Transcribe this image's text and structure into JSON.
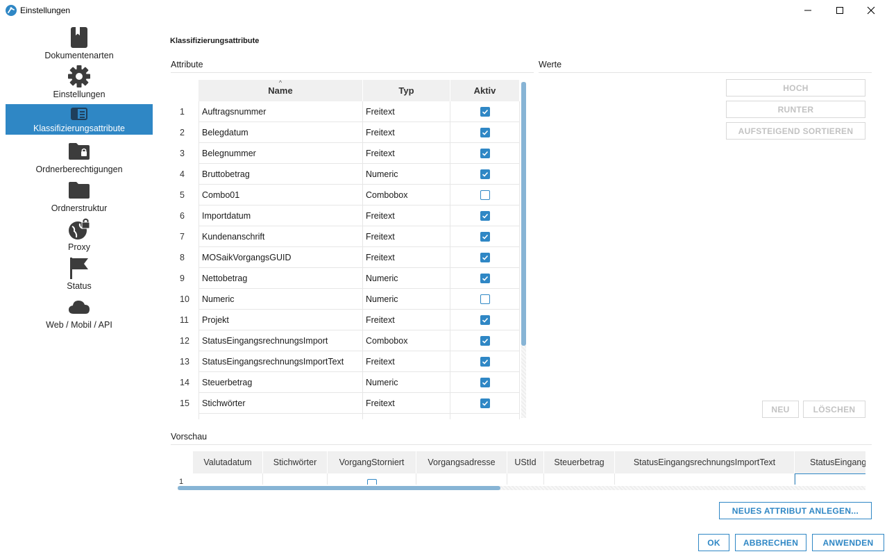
{
  "window": {
    "title": "Einstellungen"
  },
  "sidebar": {
    "items": [
      {
        "label": "Dokumentenarten",
        "icon": "bookmark-book-icon",
        "active": false
      },
      {
        "label": "Einstellungen",
        "icon": "gear-icon",
        "active": false
      },
      {
        "label": "Klassifizierungsattribute",
        "icon": "list-card-icon",
        "active": true
      },
      {
        "label": "Ordnerberechtigungen",
        "icon": "folder-lock-icon",
        "active": false
      },
      {
        "label": "Ordnerstruktur",
        "icon": "folder-icon",
        "active": false
      },
      {
        "label": "Proxy",
        "icon": "globe-lock-icon",
        "active": false
      },
      {
        "label": "Status",
        "icon": "flag-icon",
        "active": false
      },
      {
        "label": "Web / Mobil / API",
        "icon": "cloud-icon",
        "active": false
      }
    ]
  },
  "main": {
    "section_title": "Klassifizierungsattribute",
    "attributes_title": "Attribute",
    "values_title": "Werte",
    "preview_title": "Vorschau"
  },
  "attr_table": {
    "columns": [
      "Name",
      "Typ",
      "Aktiv"
    ],
    "sort_indicator": "^",
    "rows": [
      {
        "num": "1",
        "name": "Auftragsnummer",
        "typ": "Freitext",
        "aktiv": true
      },
      {
        "num": "2",
        "name": "Belegdatum",
        "typ": "Freitext",
        "aktiv": true
      },
      {
        "num": "3",
        "name": "Belegnummer",
        "typ": "Freitext",
        "aktiv": true
      },
      {
        "num": "4",
        "name": "Bruttobetrag",
        "typ": "Numeric",
        "aktiv": true
      },
      {
        "num": "5",
        "name": "Combo01",
        "typ": "Combobox",
        "aktiv": false
      },
      {
        "num": "6",
        "name": "Importdatum",
        "typ": "Freitext",
        "aktiv": true
      },
      {
        "num": "7",
        "name": "Kundenanschrift",
        "typ": "Freitext",
        "aktiv": true
      },
      {
        "num": "8",
        "name": "MOSaikVorgangsGUID",
        "typ": "Freitext",
        "aktiv": true
      },
      {
        "num": "9",
        "name": "Nettobetrag",
        "typ": "Numeric",
        "aktiv": true
      },
      {
        "num": "10",
        "name": "Numeric",
        "typ": "Numeric",
        "aktiv": false
      },
      {
        "num": "11",
        "name": "Projekt",
        "typ": "Freitext",
        "aktiv": true
      },
      {
        "num": "12",
        "name": "StatusEingangsrechnungsImport",
        "typ": "Combobox",
        "aktiv": true
      },
      {
        "num": "13",
        "name": "StatusEingangsrechnungsImportText",
        "typ": "Freitext",
        "aktiv": true
      },
      {
        "num": "14",
        "name": "Steuerbetrag",
        "typ": "Numeric",
        "aktiv": true
      },
      {
        "num": "15",
        "name": "Stichwörter",
        "typ": "Freitext",
        "aktiv": true
      },
      {
        "num": "",
        "name": "",
        "typ": "",
        "aktiv": null
      }
    ]
  },
  "values_panel": {
    "up_label": "HOCH",
    "down_label": "RUNTER",
    "sort_label": "AUFSTEIGEND SORTIEREN",
    "new_label": "NEU",
    "delete_label": "LÖSCHEN"
  },
  "preview_table": {
    "columns": [
      "Valutadatum",
      "Stichwörter",
      "VorgangStorniert",
      "Vorgangsadresse",
      "UStId",
      "Steuerbetrag",
      "StatusEingangsrechnungsImportText",
      "StatusEingang"
    ],
    "row_num": "1"
  },
  "actions": {
    "new_attribute_label": "NEUES ATTRIBUT ANLEGEN...",
    "ok_label": "OK",
    "cancel_label": "ABBRECHEN",
    "apply_label": "ANWENDEN"
  },
  "colors": {
    "accent": "#2f87c5",
    "active_nav_bg": "#2f87c5",
    "disabled_text": "#c2c2c2",
    "header_bg": "#f0f0f0",
    "scroll_thumb": "#87b4d5"
  }
}
